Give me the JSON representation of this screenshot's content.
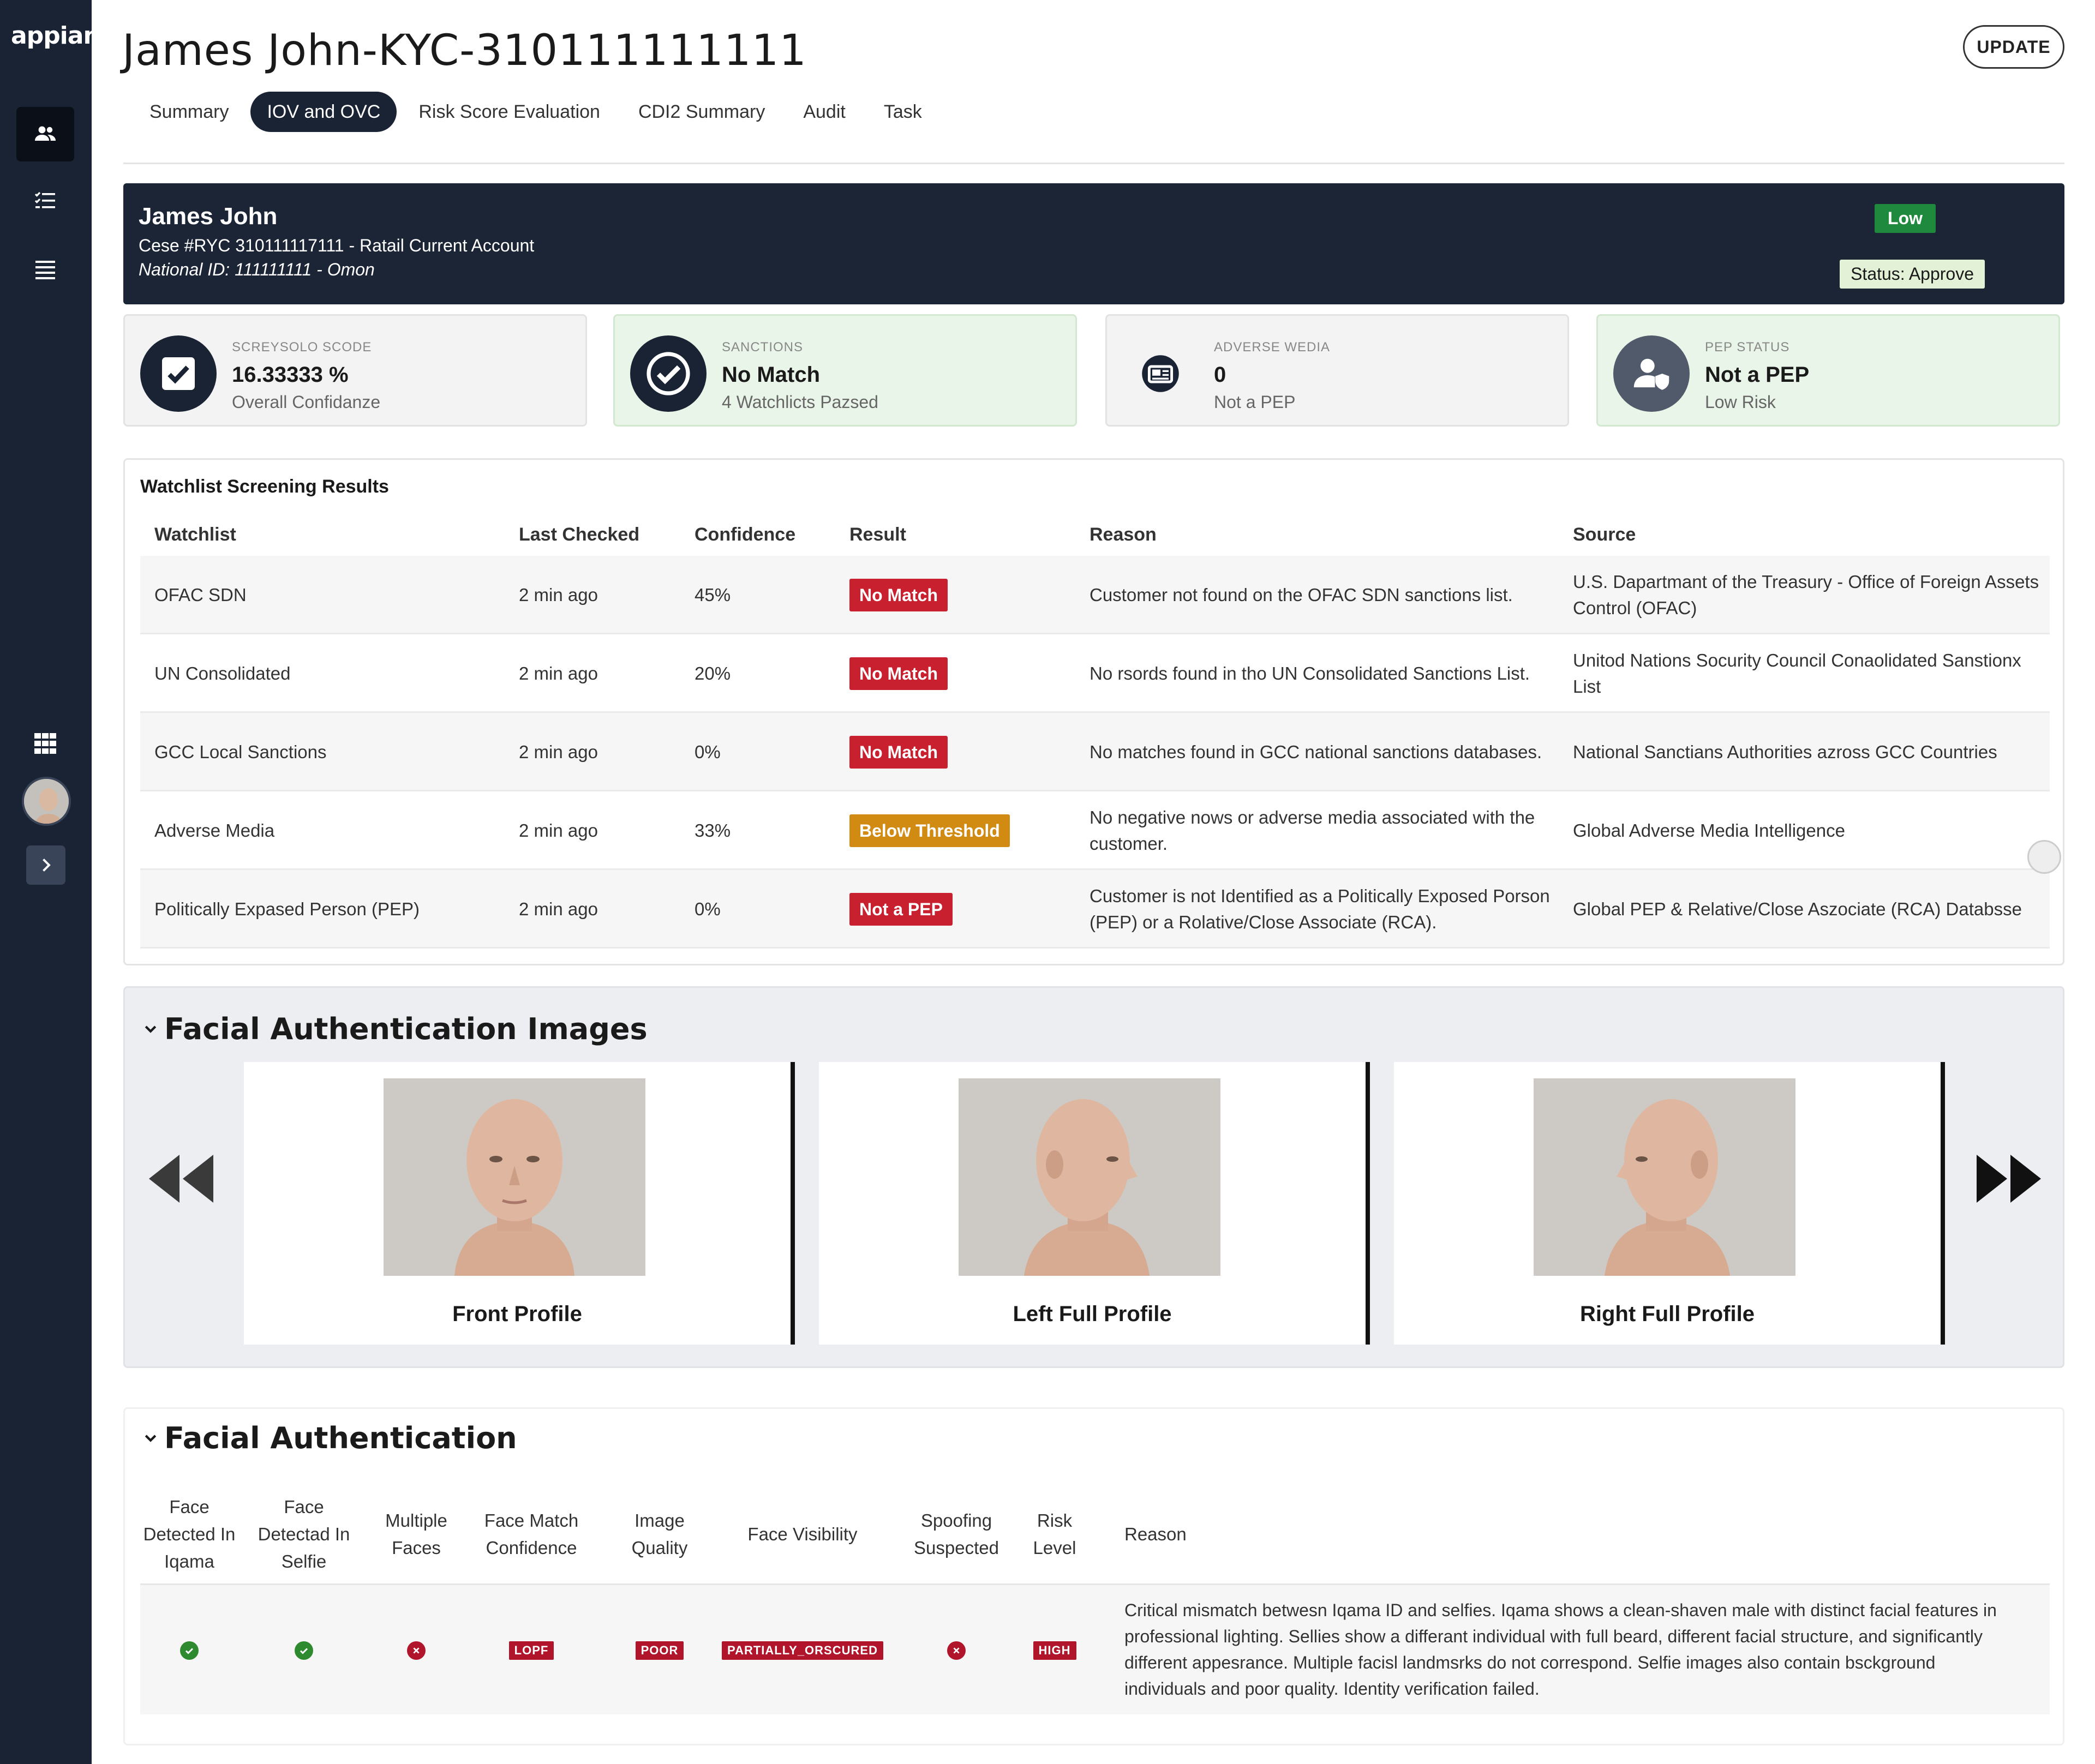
{
  "app": {
    "logo": "appian"
  },
  "sidebar": {
    "icons": [
      "users-icon",
      "checklist-icon",
      "list-icon",
      "grid-icon",
      "avatar",
      "expand-icon"
    ]
  },
  "header": {
    "title": "James John-KYC-310111111111",
    "update_label": "UPDATE",
    "tabs": [
      {
        "label": "Summary",
        "active": false
      },
      {
        "label": "IOV and OVC",
        "active": true
      },
      {
        "label": "Risk Score Evaluation",
        "active": false
      },
      {
        "label": "CDI2 Summary",
        "active": false
      },
      {
        "label": "Audit",
        "active": false
      },
      {
        "label": "Task",
        "active": false
      }
    ]
  },
  "banner": {
    "name": "James John",
    "case_line": "Cese #RYC 310111117111 -  Ratail Current Account",
    "id_line": "National ID: 111111111 - Omon",
    "risk": "Low",
    "status": "Status: Approve"
  },
  "cards": [
    {
      "small": "SCREYSOLO SCODE",
      "big": "16.33333 %",
      "sub": "Overall Confidanze",
      "icon": "checkbox-icon"
    },
    {
      "small": "SANCTIONS",
      "big": "No Match",
      "sub": "4 Watchlicts Pazsed",
      "icon": "check-circle-icon"
    },
    {
      "small": "ADVERSE WEDIA",
      "big": "0",
      "sub": "Not a PEP",
      "icon": "media-icon"
    },
    {
      "small": "PEP STATUS",
      "big": "Not a PEP",
      "sub": "Low Risk",
      "icon": "user-shield-icon"
    }
  ],
  "watchlist": {
    "title": "Watchlist Screening Results",
    "columns": [
      "Watchlist",
      "Last Checked",
      "Confidence",
      "Result",
      "Reason",
      "Source"
    ],
    "rows": [
      {
        "watchlist": "OFAC SDN",
        "checked": "2 min ago",
        "confidence": "45%",
        "result": "No Match",
        "result_color": "red",
        "reason": "Customer not found on the OFAC SDN sanctions list.",
        "source": "U.S. Dapartmant of the Treasury - Office of Foreign Assets Control (OFAC)"
      },
      {
        "watchlist": "UN Consolidated",
        "checked": "2 min ago",
        "confidence": "20%",
        "result": "No Match",
        "result_color": "red",
        "reason": "No rsords found in tho UN Consolidated Sanctions List.",
        "source": "Unitod Nations Socurity Council Conaolidated Sanstionx List"
      },
      {
        "watchlist": "GCC Local Sanctions",
        "checked": "2 min ago",
        "confidence": "0%",
        "result": "No Match",
        "result_color": "red",
        "reason": "No matches found in GCC national sanctions databases.",
        "source": "National Sanctians Authorities azross GCC Countries"
      },
      {
        "watchlist": "Adverse Media",
        "checked": "2 min ago",
        "confidence": "33%",
        "result": "Below Threshold",
        "result_color": "amber",
        "reason": "No negative nows or adverse media associated with the customer.",
        "source": "Global Adverse Media Intelligence"
      },
      {
        "watchlist": "Politically Expased Person (PEP)",
        "checked": "2 min ago",
        "confidence": "0%",
        "result": "Not a PEP",
        "result_color": "red",
        "reason": "Customer is not Identified as a Politically Exposed Porson (PEP) or a Rolative/Close Associate (RCA).",
        "source": "Global PEP & Relative/Close Aszociate (RCA) Databsse"
      }
    ]
  },
  "facial_images": {
    "title": "Facial Authentication Images",
    "photos": [
      {
        "label": "Front Profile"
      },
      {
        "label": "Left Full Profile"
      },
      {
        "label": "Right Full Profile"
      }
    ]
  },
  "facial_auth": {
    "title": "Facial Authentication",
    "columns": [
      "Face Detected In Iqama",
      "Face Detectad In Selfie",
      "Multiple Faces",
      "Face Match Confidence",
      "Image Quality",
      "Face Visibility",
      "Spoofing Suspected",
      "Risk Level",
      "Reason"
    ],
    "row": {
      "face_iqama": "ok",
      "face_selfie": "ok",
      "multiple_faces": "bad",
      "match_confidence": "LOPF",
      "image_quality": "POOR",
      "face_visibility": "PARTIALLY_ORSCURED",
      "spoofing": "bad",
      "risk_level": "HIGH",
      "reason": "Critical mismatch betwesn Iqama ID and selfies. Iqama shows a clean-shaven male with distinct facial features in professional lighting. Sellies show a differant individual with full beard, different facial structure, and significantly different appesrance. Multiple facisl landmsrks do not correspond. Selfie images also contain bsckground individuals and poor quality. Identity verification failed."
    }
  },
  "colors": {
    "sidebar": "#1a2333",
    "banner": "#1c2536",
    "risk_low": "#1f8a3d",
    "danger": "#c8202e",
    "warning": "#d18a12"
  }
}
